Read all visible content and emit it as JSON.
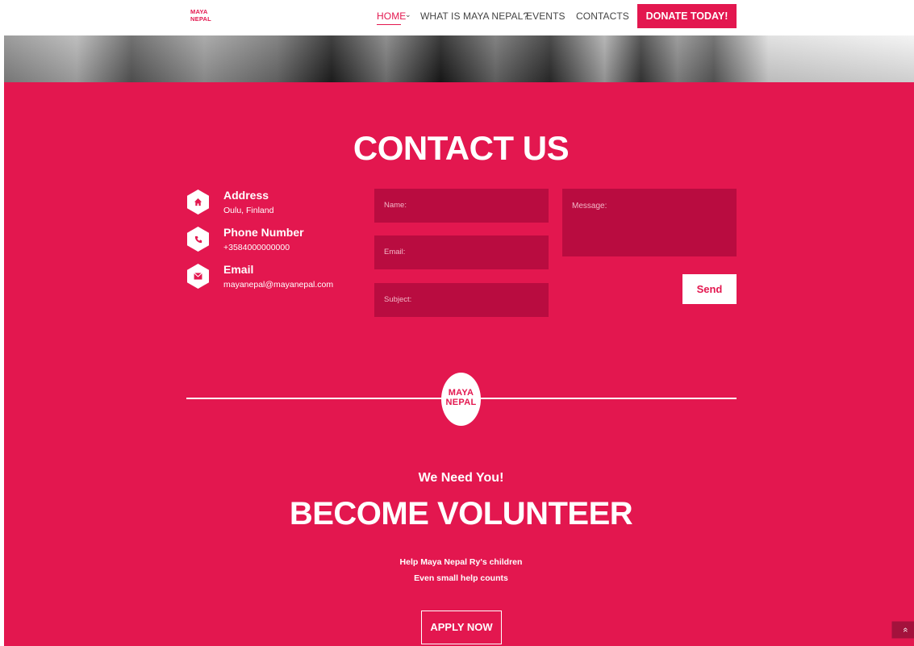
{
  "nav": {
    "logo_line1": "MAYA",
    "logo_line2": "NEPAL",
    "home": "HOME",
    "what": "WHAT IS MAYA NEPAL?",
    "events": "EVENTS",
    "contacts": "CONTACTS",
    "donate": "DONATE TODAY!"
  },
  "contact": {
    "title": "CONTACT US",
    "address_label": "Address",
    "address_value": "Oulu, Finland",
    "phone_label": "Phone Number",
    "phone_value": "+3584000000000",
    "email_label": "Email",
    "email_value": "mayanepal@mayanepal.com",
    "name_placeholder": "Name:",
    "email_placeholder": "Email:",
    "subject_placeholder": "Subject:",
    "message_placeholder": "Message:",
    "send": "Send"
  },
  "badge": {
    "line1": "MAYA",
    "line2": "NEPAL"
  },
  "volunteer": {
    "kicker": "We Need You!",
    "title": "BECOME VOLUNTEER",
    "line1": "Help Maya Nepal Ry's children",
    "line2": "Even small help counts",
    "apply": "APPLY NOW"
  },
  "colors": {
    "brand": "#e3174f",
    "field": "#b90c40"
  },
  "icons": {
    "address": "home-icon",
    "phone": "phone-icon",
    "email": "envelope-icon",
    "scroll": "double-chevron-up-icon"
  }
}
